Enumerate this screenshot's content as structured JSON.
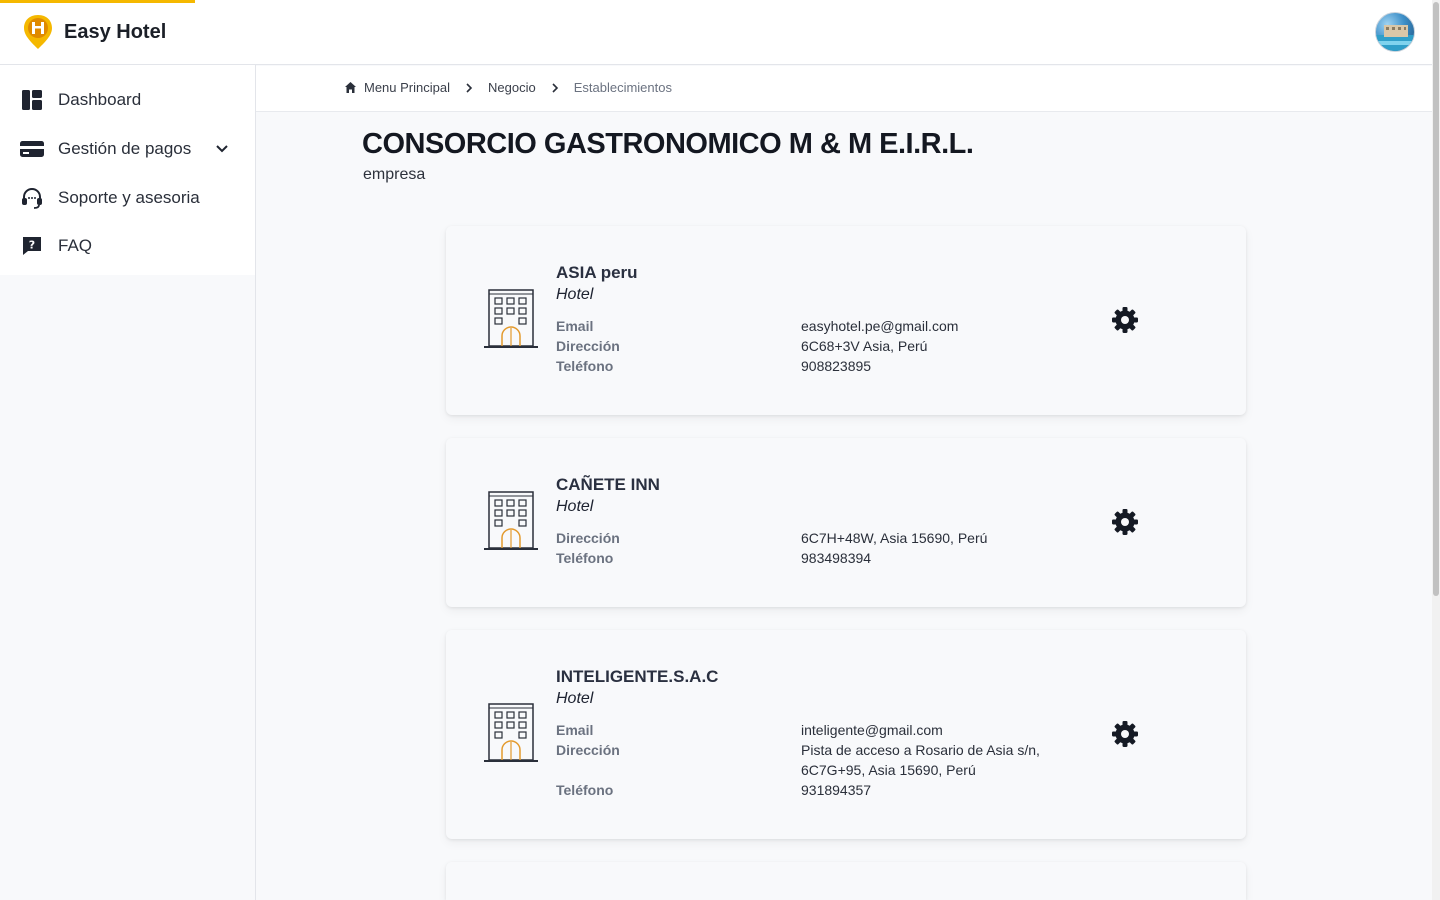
{
  "app": {
    "name": "Easy Hotel"
  },
  "sidebar": {
    "items": [
      {
        "label": "Dashboard",
        "icon": "dashboard-icon"
      },
      {
        "label": "Gestión de pagos",
        "icon": "card-icon",
        "has_submenu": true
      },
      {
        "label": "Soporte y asesoria",
        "icon": "headset-icon"
      },
      {
        "label": "FAQ",
        "icon": "faq-icon"
      }
    ]
  },
  "breadcrumb": {
    "items": [
      "Menu Principal",
      "Negocio",
      "Establecimientos"
    ]
  },
  "page": {
    "title": "CONSORCIO GASTRONOMICO M & M E.I.R.L.",
    "subtitle": "empresa"
  },
  "establishments": [
    {
      "name": "ASIA peru",
      "type": "Hotel",
      "fields": [
        {
          "label": "Email",
          "value": "easyhotel.pe@gmail.com"
        },
        {
          "label": "Dirección",
          "value": "6C68+3V Asia, Perú"
        },
        {
          "label": "Teléfono",
          "value": "908823895"
        }
      ]
    },
    {
      "name": "CAÑETE INN",
      "type": "Hotel",
      "fields": [
        {
          "label": "Dirección",
          "value": "6C7H+48W, Asia 15690, Perú"
        },
        {
          "label": "Teléfono",
          "value": "983498394"
        }
      ]
    },
    {
      "name": "INTELIGENTE.S.A.C",
      "type": "Hotel",
      "fields": [
        {
          "label": "Email",
          "value": "inteligente@gmail.com"
        },
        {
          "label": "Dirección",
          "value": "Pista de acceso a Rosario de Asia s/n, 6C7G+95, Asia 15690, Perú"
        },
        {
          "label": "Teléfono",
          "value": "931894357"
        }
      ]
    }
  ],
  "colors": {
    "accent": "#f5b800",
    "text_dark": "#141821",
    "label_gray": "#6b7280",
    "background": "#f8f9fb"
  }
}
